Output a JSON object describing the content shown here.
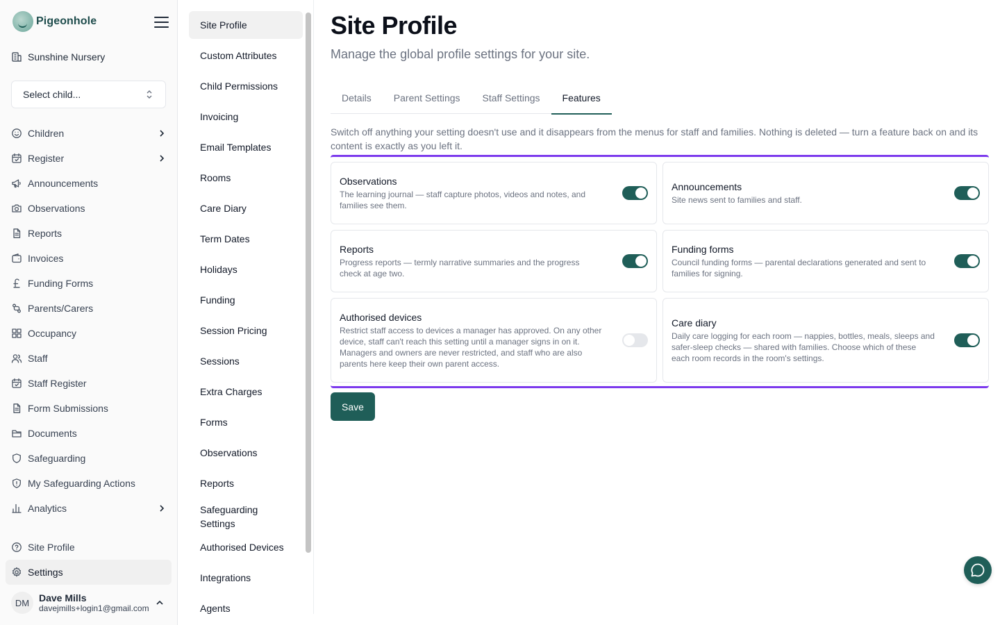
{
  "brand": {
    "name": "Pigeonhole"
  },
  "site": {
    "name": "Sunshine Nursery"
  },
  "child_select": {
    "label": "Select child..."
  },
  "nav": {
    "items": [
      {
        "label": "Children",
        "icon": "smile-icon",
        "chevron": true
      },
      {
        "label": "Register",
        "icon": "calendar-check-icon",
        "chevron": true
      },
      {
        "label": "Announcements",
        "icon": "megaphone-icon",
        "chevron": false
      },
      {
        "label": "Observations",
        "icon": "camera-icon",
        "chevron": false
      },
      {
        "label": "Reports",
        "icon": "file-text-icon",
        "chevron": false
      },
      {
        "label": "Invoices",
        "icon": "wallet-icon",
        "chevron": false
      },
      {
        "label": "Funding Forms",
        "icon": "pound-icon",
        "chevron": false
      },
      {
        "label": "Parents/Carers",
        "icon": "link-icon",
        "chevron": false
      },
      {
        "label": "Occupancy",
        "icon": "grid-icon",
        "chevron": false
      },
      {
        "label": "Staff",
        "icon": "users-icon",
        "chevron": false
      },
      {
        "label": "Staff Register",
        "icon": "calendar-check-icon",
        "chevron": false
      },
      {
        "label": "Form Submissions",
        "icon": "file-text-icon",
        "chevron": false
      },
      {
        "label": "Documents",
        "icon": "folder-icon",
        "chevron": false
      },
      {
        "label": "Safeguarding",
        "icon": "shield-icon",
        "chevron": false
      },
      {
        "label": "My Safeguarding Actions",
        "icon": "shield-alert-icon",
        "chevron": false
      },
      {
        "label": "Analytics",
        "icon": "bar-chart-icon",
        "chevron": true
      }
    ],
    "bottom": [
      {
        "label": "Site Profile",
        "icon": "help-circle-icon"
      },
      {
        "label": "Settings",
        "icon": "gear-icon"
      }
    ]
  },
  "user": {
    "initials": "DM",
    "name": "Dave Mills",
    "email": "davejmills+login1@gmail.com"
  },
  "subnav": {
    "items": [
      "Site Profile",
      "Custom Attributes",
      "Child Permissions",
      "Invoicing",
      "Email Templates",
      "Rooms",
      "Care Diary",
      "Term Dates",
      "Holidays",
      "Funding",
      "Session Pricing",
      "Sessions",
      "Extra Charges",
      "Forms",
      "Observations",
      "Reports",
      "Safeguarding Settings",
      "Authorised Devices",
      "Integrations",
      "Agents"
    ]
  },
  "page": {
    "title": "Site Profile",
    "subtitle": "Manage the global profile settings for your site.",
    "tabs": [
      "Details",
      "Parent Settings",
      "Staff Settings",
      "Features"
    ],
    "active_tab": "Features",
    "intro": "Switch off anything your setting doesn't use and it disappears from the menus for staff and families. Nothing is deleted — turn a feature back on and its content is exactly as you left it.",
    "features": [
      {
        "title": "Observations",
        "desc": "The learning journal — staff capture photos, videos and notes, and families see them.",
        "enabled": true
      },
      {
        "title": "Announcements",
        "desc": "Site news sent to families and staff.",
        "enabled": true
      },
      {
        "title": "Reports",
        "desc": "Progress reports — termly narrative summaries and the progress check at age two.",
        "enabled": true
      },
      {
        "title": "Funding forms",
        "desc": "Council funding forms — parental declarations generated and sent to families for signing.",
        "enabled": true
      },
      {
        "title": "Authorised devices",
        "desc": "Restrict staff access to devices a manager has approved. On any other device, staff can't reach this setting until a manager signs in on it. Managers and owners are never restricted, and staff who are also parents here keep their own parent access.",
        "enabled": false
      },
      {
        "title": "Care diary",
        "desc": "Daily care logging for each room — nappies, bottles, meals, sleeps and safer-sleep checks — shared with families. Choose which of these each room records in the room's settings.",
        "enabled": true
      }
    ],
    "save_label": "Save"
  },
  "colors": {
    "accent": "#1f5e58",
    "highlight": "#7c3aed"
  }
}
